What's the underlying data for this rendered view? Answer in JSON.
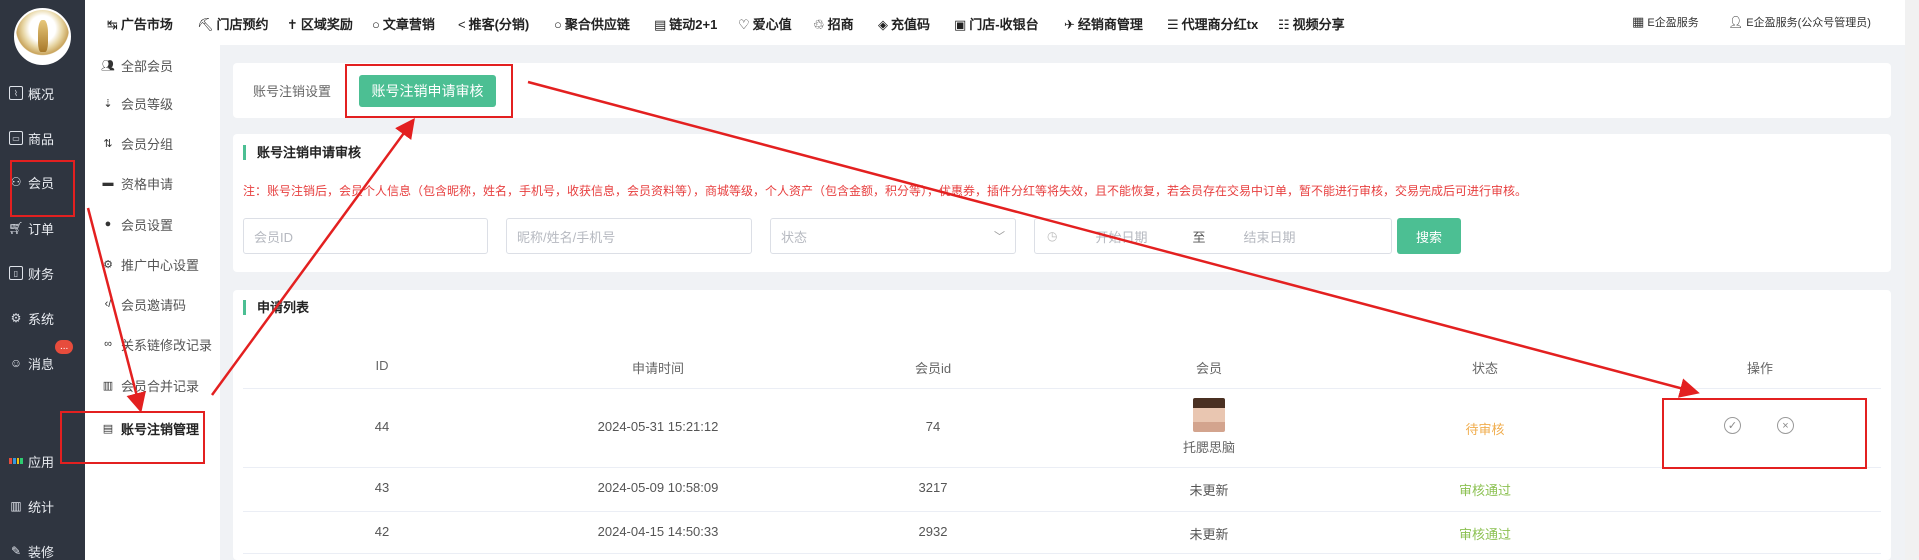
{
  "sidebar": {
    "items": [
      {
        "label": "概况",
        "icon": "chart-icon"
      },
      {
        "label": "商品",
        "icon": "goods-icon"
      },
      {
        "label": "会员",
        "icon": "member-icon"
      },
      {
        "label": "订单",
        "icon": "cart-icon"
      },
      {
        "label": "财务",
        "icon": "finance-icon"
      },
      {
        "label": "系统",
        "icon": "gear-icon"
      },
      {
        "label": "消息",
        "icon": "message-icon",
        "badge": "..."
      },
      {
        "label": "应用",
        "icon": "apps-icon"
      },
      {
        "label": "统计",
        "icon": "stats-icon"
      },
      {
        "label": "装修",
        "icon": "decorate-icon"
      }
    ]
  },
  "submenu": {
    "items": [
      {
        "label": "全部会员",
        "icon": "users-icon"
      },
      {
        "label": "会员等级",
        "icon": "sort-icon"
      },
      {
        "label": "会员分组",
        "icon": "sort-az-icon"
      },
      {
        "label": "资格申请",
        "icon": "folder-icon"
      },
      {
        "label": "会员设置",
        "icon": "user-icon"
      },
      {
        "label": "推广中心设置",
        "icon": "gear-icon"
      },
      {
        "label": "会员邀请码",
        "icon": "code-icon"
      },
      {
        "label": "关系链修改记录",
        "icon": "link-icon"
      },
      {
        "label": "会员合并记录",
        "icon": "bar-chart-icon"
      },
      {
        "label": "账号注销管理",
        "icon": "file-icon"
      }
    ]
  },
  "topbar": {
    "items": [
      {
        "label": "广告市场",
        "icon": "↹"
      },
      {
        "label": "门店预约",
        "icon": "⛏"
      },
      {
        "label": "区域奖励",
        "icon": "✝"
      },
      {
        "label": "文章营销",
        "icon": "○"
      },
      {
        "label": "推客(分销)",
        "icon": "<"
      },
      {
        "label": "聚合供应链",
        "icon": "○"
      },
      {
        "label": "链动2+1",
        "icon": "▤"
      },
      {
        "label": "爱心值",
        "icon": "♡"
      },
      {
        "label": "招商",
        "icon": "♲"
      },
      {
        "label": "充值码",
        "icon": "◈"
      },
      {
        "label": "门店-收银台",
        "icon": "▣"
      },
      {
        "label": "经销商管理",
        "icon": "✈"
      },
      {
        "label": "代理商分红tx",
        "icon": "☰"
      },
      {
        "label": "视频分享",
        "icon": "☷"
      }
    ],
    "service": "E企盈服务",
    "user": "E企盈服务(公众号管理员)"
  },
  "tabs": {
    "inactive": "账号注销设置",
    "active": "账号注销申请审核"
  },
  "filter": {
    "title": "账号注销申请审核",
    "notice": "注：账号注销后，会员个人信息（包含昵称，姓名，手机号，收获信息，会员资料等），商城等级，个人资产（包含金额，积分等），优惠券，插件分红等将失效，且不能恢复，若会员存在交易中订单，暂不能进行审核，交易完成后可进行审核。",
    "member_id_placeholder": "会员ID",
    "name_placeholder": "昵称/姓名/手机号",
    "status_placeholder": "状态",
    "start_date_placeholder": "开始日期",
    "date_separator": "至",
    "end_date_placeholder": "结束日期",
    "search_label": "搜索"
  },
  "list": {
    "title": "申请列表",
    "columns": [
      "ID",
      "申请时间",
      "会员id",
      "会员",
      "状态",
      "操作"
    ],
    "rows": [
      {
        "id": "44",
        "time": "2024-05-31 15:21:12",
        "member_id": "74",
        "member": "托腮思脑",
        "status": "待审核"
      },
      {
        "id": "43",
        "time": "2024-05-09 10:58:09",
        "member_id": "3217",
        "member": "未更新",
        "status": "审核通过"
      },
      {
        "id": "42",
        "time": "2024-04-15 14:50:33",
        "member_id": "2932",
        "member": "未更新",
        "status": "审核通过"
      }
    ]
  },
  "colors": {
    "accent": "#4cbf93",
    "annotation": "#e32020",
    "notice": "#e73f3f",
    "pending": "#f0ad4e",
    "approved": "#8cc152"
  }
}
